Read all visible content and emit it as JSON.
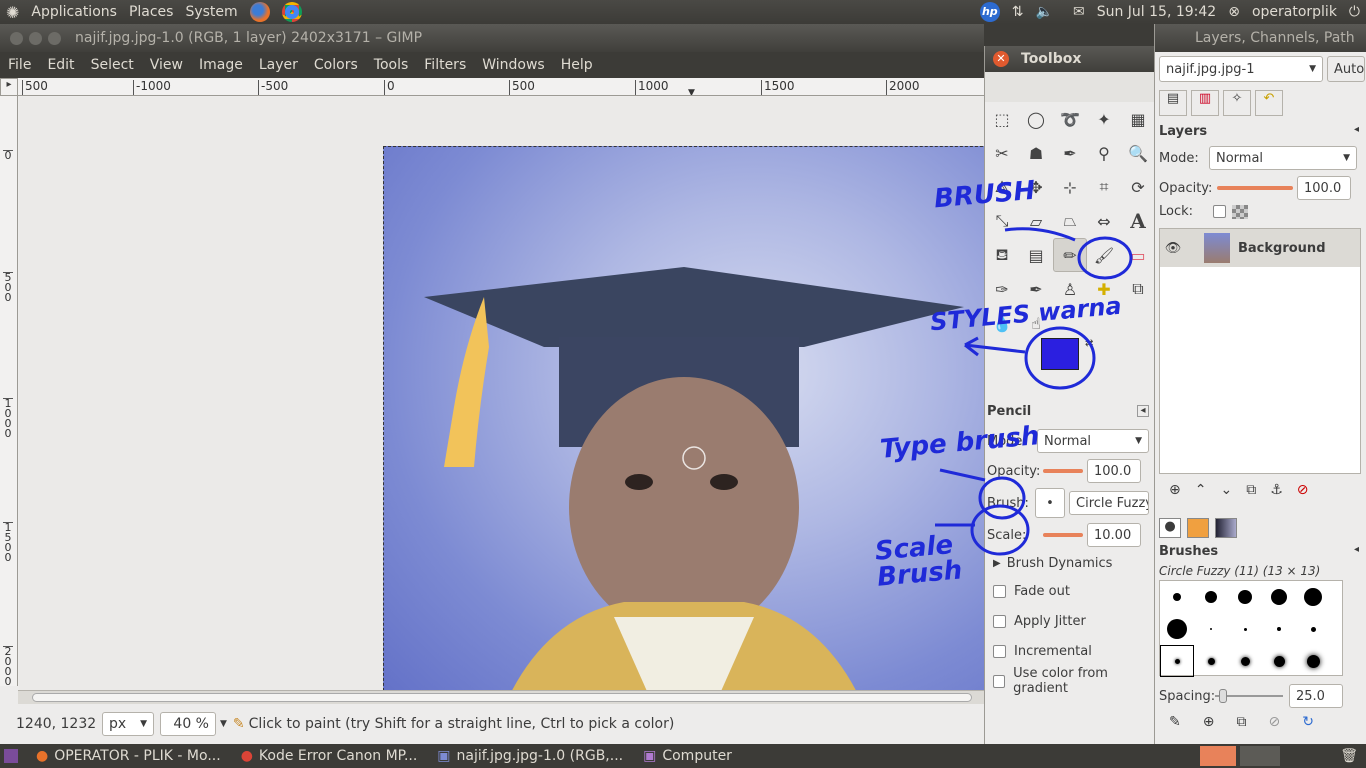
{
  "topbar": {
    "menus": [
      "Applications",
      "Places",
      "System"
    ],
    "clock": "Sun Jul 15, 19:42",
    "user": "operatorplik"
  },
  "gimp": {
    "title": "najif.jpg.jpg-1.0 (RGB, 1 layer) 2402x3171 – GIMP",
    "menus": [
      "File",
      "Edit",
      "Select",
      "View",
      "Image",
      "Layer",
      "Colors",
      "Tools",
      "Filters",
      "Windows",
      "Help"
    ],
    "ruler_h": [
      "500",
      "-1000",
      "-500",
      "0",
      "500",
      "1000",
      "1500",
      "2000"
    ],
    "ruler_v": [
      "0",
      "500",
      "1000",
      "1500",
      "2000"
    ],
    "coords": "1240, 1232",
    "unit": "px",
    "zoom": "40 %",
    "status": "Click to paint (try Shift for a straight line, Ctrl to pick a color)"
  },
  "toolbox": {
    "title": "Toolbox",
    "fg_color": "#2b1fe0",
    "options_title": "Pencil",
    "mode_label": "Mode:",
    "mode_value": "Normal",
    "opacity_label": "Opacity:",
    "opacity_value": "100.0",
    "brush_label": "Brush:",
    "brush_value": "Circle Fuzzy (",
    "scale_label": "Scale:",
    "scale_value": "10.00",
    "brush_dynamics": "Brush Dynamics",
    "checks": [
      "Fade out",
      "Apply Jitter",
      "Incremental",
      "Use color from gradient"
    ]
  },
  "dock": {
    "title": "Layers, Channels, Path",
    "image_select": "najif.jpg.jpg-1",
    "auto": "Auto",
    "layers_title": "Layers",
    "mode_label": "Mode:",
    "mode_value": "Normal",
    "opacity_label": "Opacity:",
    "opacity_value": "100.0",
    "lock_label": "Lock:",
    "layer_name": "Background",
    "brushes_title": "Brushes",
    "brush_name": "Circle Fuzzy (11) (13 × 13)",
    "spacing_label": "Spacing:",
    "spacing_value": "25.0"
  },
  "annotations": {
    "brush": "BRUSH",
    "styles": "STYLES warna",
    "type_brush": "Type brush",
    "scale_brush": "Scale Brush"
  },
  "taskbar": {
    "items": [
      "OPERATOR - PLIK - Mo...",
      "Kode Error Canon MP...",
      "najif.jpg.jpg-1.0 (RGB,...",
      "Computer"
    ]
  }
}
